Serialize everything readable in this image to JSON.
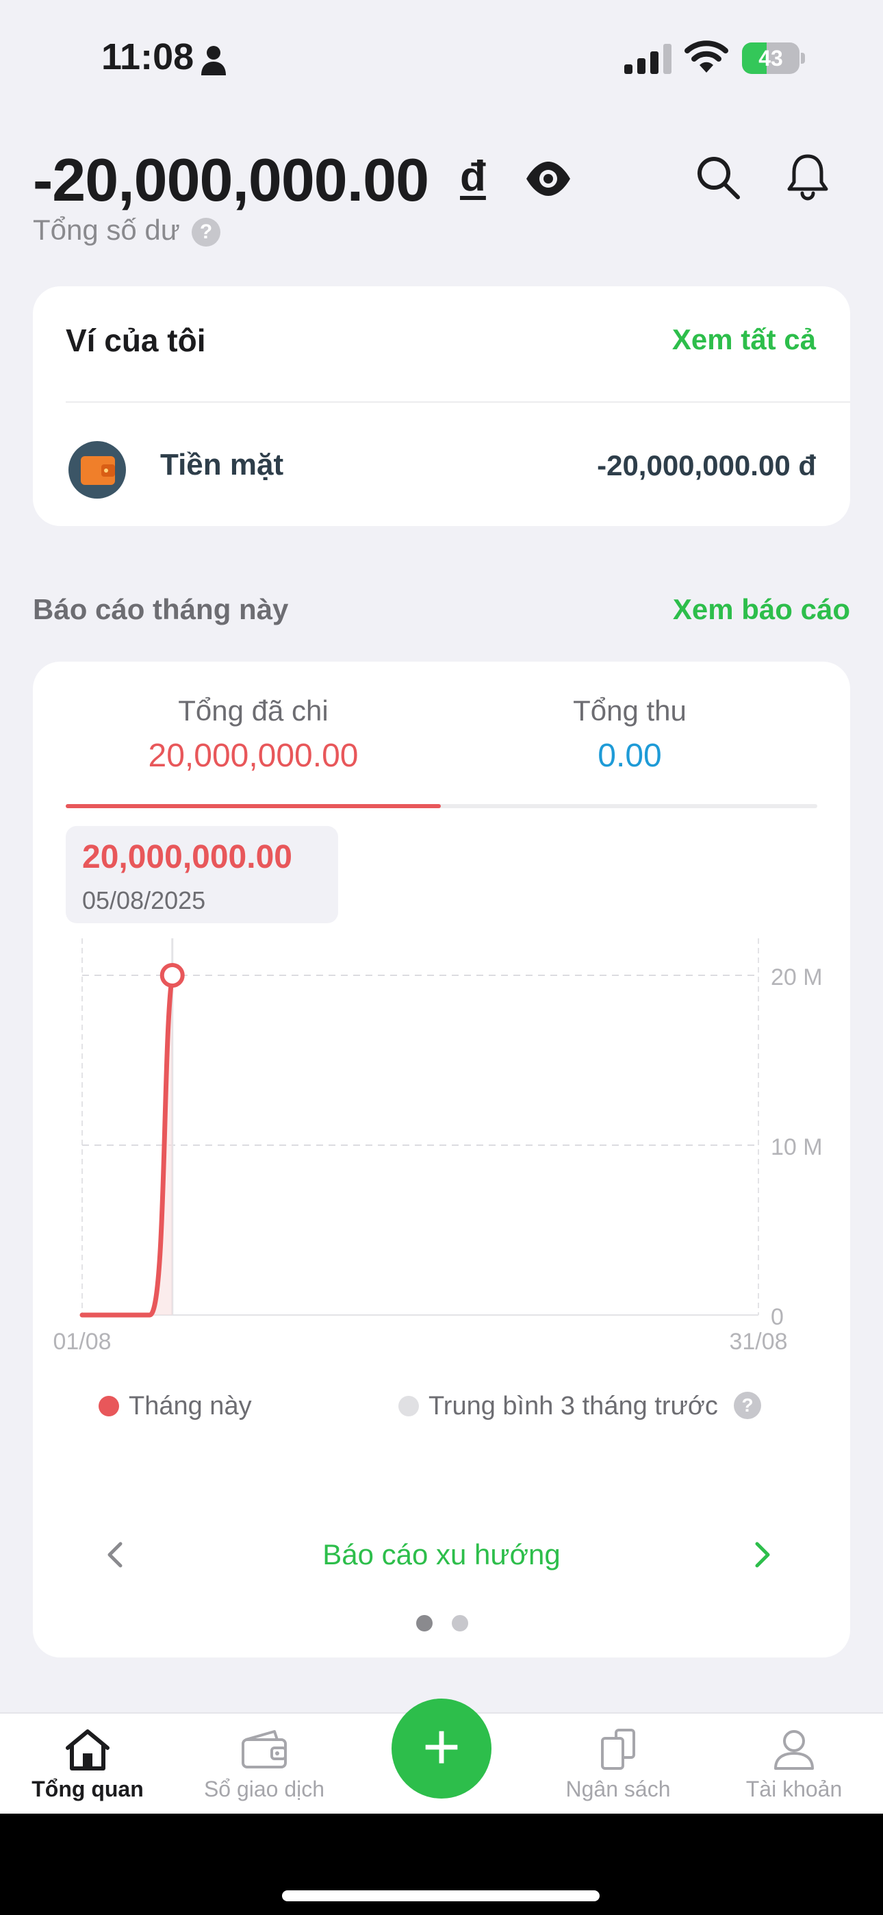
{
  "status_bar": {
    "time": "11:08",
    "battery_percent": "43",
    "battery_level": 0.43,
    "icons": [
      "person-icon",
      "signal-icon",
      "wifi-icon",
      "battery-charging-icon"
    ]
  },
  "header": {
    "balance_amount": "-20,000,000.00",
    "currency": "đ",
    "balance_label": "Tổng số dư",
    "help_symbol": "?",
    "icons": [
      "eye-icon",
      "search-icon",
      "bell-icon"
    ]
  },
  "wallet": {
    "title": "Ví của tôi",
    "see_all": "Xem tất cả",
    "items": [
      {
        "name": "Tiền mặt",
        "amount": "-20,000,000.00 đ",
        "icon": "wallet-icon"
      }
    ]
  },
  "report": {
    "heading": "Báo cáo tháng này",
    "see_report": "Xem báo cáo",
    "tabs": [
      {
        "label": "Tổng đã chi",
        "value": "20,000,000.00",
        "active": true
      },
      {
        "label": "Tổng thu",
        "value": "0.00",
        "active": false
      }
    ],
    "tooltip": {
      "value": "20,000,000.00",
      "date": "05/08/2025"
    },
    "legend": [
      {
        "label": "Tháng này",
        "color": "#e8575a"
      },
      {
        "label": "Trung bình 3 tháng trước",
        "color": "#e0e0e3"
      }
    ],
    "legend_help": "?",
    "trend_link": "Báo cáo xu hướng",
    "page_count": 2,
    "page_active": 1
  },
  "chart_data": {
    "type": "line",
    "x_start_label": "01/08",
    "x_end_label": "31/08",
    "y_tick_labels": [
      "20 M",
      "10 M",
      "0"
    ],
    "ylim": [
      0,
      20000000
    ],
    "xlim": [
      1,
      31
    ],
    "grid": true,
    "series": [
      {
        "name": "Tháng này",
        "color": "#e8575a",
        "x": [
          1,
          2,
          3,
          4,
          5
        ],
        "y": [
          0,
          0,
          0,
          0,
          20000000
        ]
      }
    ],
    "highlight": {
      "x": 5,
      "y": 20000000
    }
  },
  "tabbar": {
    "items": [
      {
        "label": "Tổng quan",
        "icon": "home-icon",
        "active": true
      },
      {
        "label": "Sổ giao dịch",
        "icon": "wallet-icon",
        "active": false
      },
      {
        "label": "Ngân sách",
        "icon": "budget-icon",
        "active": false
      },
      {
        "label": "Tài khoản",
        "icon": "account-icon",
        "active": false
      }
    ],
    "fab_symbol": "+"
  },
  "colors": {
    "accent_green": "#2dbe4b",
    "expense_red": "#e8575a",
    "income_blue": "#1e9bd7",
    "background": "#f1f1f6"
  }
}
